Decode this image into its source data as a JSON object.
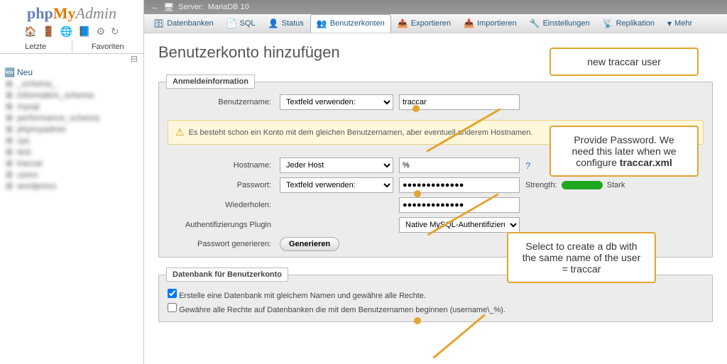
{
  "logo": {
    "part1": "php",
    "part2": "My",
    "part3": "Admin"
  },
  "sidebar_tabs": {
    "recent": "Letzte",
    "favorites": "Favoriten"
  },
  "tree": {
    "new": "Neu",
    "items": [
      "_schema_",
      "information_schema",
      "mysql",
      "performance_schema",
      "phpmyadmin",
      "sys",
      "test",
      "traccar",
      "users",
      "wordpress"
    ]
  },
  "topbar": {
    "server_label": "Server:",
    "server_name": "MariaDB 10"
  },
  "tabs": [
    {
      "label": "Datenbanken"
    },
    {
      "label": "SQL"
    },
    {
      "label": "Status"
    },
    {
      "label": "Benutzerkonten",
      "active": true
    },
    {
      "label": "Exportieren"
    },
    {
      "label": "Importieren"
    },
    {
      "label": "Einstellungen"
    },
    {
      "label": "Replikation"
    },
    {
      "label": "Mehr"
    }
  ],
  "page_title": "Benutzerkonto hinzufügen",
  "fieldset1_legend": "Anmeldeinformation",
  "labels": {
    "username": "Benutzername:",
    "hostname": "Hostname:",
    "password": "Passwort:",
    "repeat": "Wiederholen:",
    "authplugin": "Authentifizierungs Plugin",
    "genpass": "Passwort generieren:"
  },
  "selects": {
    "username_mode": "Textfeld verwenden:",
    "hostname_mode": "Jeder Host",
    "password_mode": "Textfeld verwenden:",
    "authplugin": "Native MySQL-Authentifizierung"
  },
  "inputs": {
    "username": "traccar",
    "hostname": "%",
    "password": "●●●●●●●●●●●●●",
    "repeat": "●●●●●●●●●●●●●"
  },
  "warning_text": "Es besteht schon ein Konto mit dem gleichen Benutzernamen, aber eventuell anderem Hostnamen.",
  "strength_label": "Strength:",
  "strength_value": "Stark",
  "gen_button": "Generieren",
  "fieldset2_legend": "Datenbank für Benutzerkonto",
  "checks": {
    "c1": "Erstelle eine Datenbank mit gleichem Namen und gewähre alle Rechte.",
    "c2": "Gewähre alle Rechte auf Datenbanken die mit dem Benutzernamen beginnen (username\\_%)."
  },
  "callouts": {
    "c1": "new traccar user",
    "c2_l1": "Provide Password. We",
    "c2_l2": "need this later when we",
    "c2_l3_a": "configure ",
    "c2_l3_b": "traccar.xml",
    "c3_l1": "Select to create a db with",
    "c3_l2": "the same name of the user",
    "c3_l3": "= traccar"
  }
}
